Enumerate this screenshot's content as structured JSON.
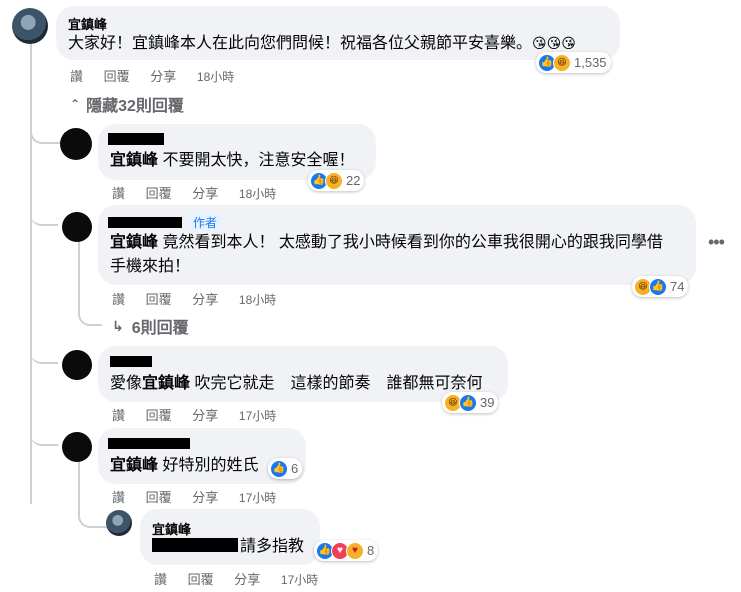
{
  "actions": {
    "like": "讚",
    "reply": "回覆",
    "share": "分享"
  },
  "main_comment": {
    "author": "宜鎮峰",
    "text": "大家好！宜鎮峰本人在此向您們問候！祝福各位父親節平安喜樂。",
    "emoji": "😘😘😘",
    "time": "18小時",
    "reaction_count": "1,535"
  },
  "hide_replies": "隱藏32則回覆",
  "replies": [
    {
      "mention": "宜鎮峰",
      "text": " 不要開太快，注意安全喔！",
      "time": "18小時",
      "reaction_count": "22"
    },
    {
      "mention": "宜鎮峰",
      "badge": "作者",
      "text_line1": " 竟然看到本人！ 太感動了我小時候看到你的公車我很開心的跟我同學借",
      "text_line2": "手機來拍！",
      "time": "18小時",
      "reaction_count": "74",
      "more_replies": "6則回覆"
    },
    {
      "prefix": "愛像",
      "mention": "宜鎮峰",
      "text": " 吹完它就走　這樣的節奏　誰都無可奈何",
      "time": "17小時",
      "reaction_count": "39"
    },
    {
      "mention": "宜鎮峰",
      "text": " 好特別的姓氏",
      "time": "17小時",
      "reaction_count": "6"
    }
  ],
  "nested_reply": {
    "author": "宜鎮峰",
    "text": "請多指教",
    "time": "17小時",
    "reaction_count": "8"
  },
  "icons": {
    "more": "more-options-icon",
    "chevron_up": "chevron-up-icon",
    "reply_arrow": "reply-arrow-icon"
  }
}
